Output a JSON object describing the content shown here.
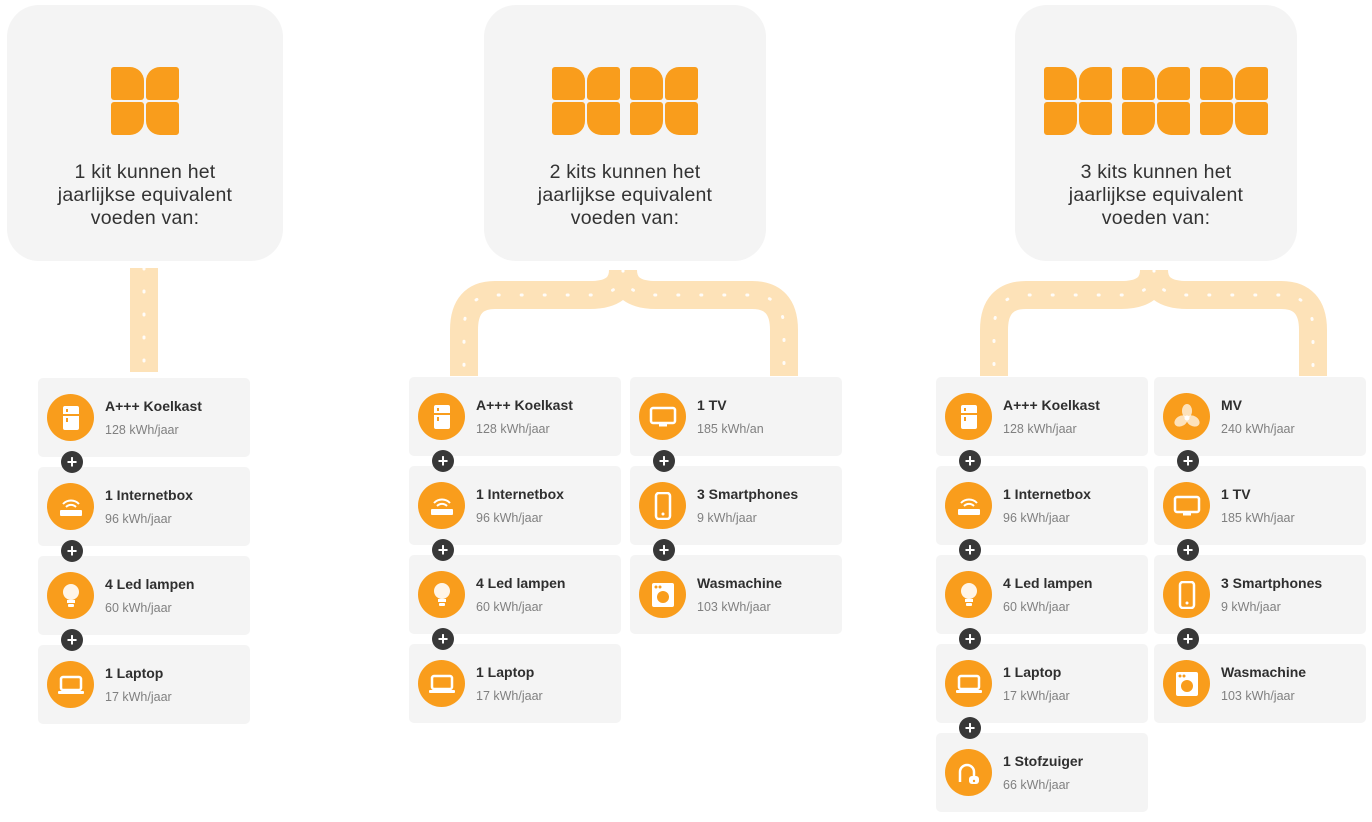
{
  "colors": {
    "accent": "#f99d1c",
    "card_bg": "#f4f4f4",
    "plus_bg": "#383838"
  },
  "groups": [
    {
      "kits": 1,
      "header": [
        "1 kit kunnen het",
        "jaarlijkse equivalent",
        "voeden van:"
      ],
      "columns": [
        [
          {
            "icon": "fridge-icon",
            "name": "A+++ Koelkast",
            "value": "128 kWh/jaar"
          },
          {
            "icon": "internetbox-icon",
            "name": "1 Internetbox",
            "value": "96 kWh/jaar"
          },
          {
            "icon": "led-bulb-icon",
            "name": "4 Led lampen",
            "value": "60 kWh/jaar"
          },
          {
            "icon": "laptop-icon",
            "name": "1 Laptop",
            "value": "17 kWh/jaar"
          }
        ]
      ]
    },
    {
      "kits": 2,
      "header": [
        "2 kits kunnen het",
        "jaarlijkse equivalent",
        "voeden van:"
      ],
      "columns": [
        [
          {
            "icon": "fridge-icon",
            "name": "A+++ Koelkast",
            "value": "128 kWh/jaar"
          },
          {
            "icon": "internetbox-icon",
            "name": "1 Internetbox",
            "value": "96 kWh/jaar"
          },
          {
            "icon": "led-bulb-icon",
            "name": "4 Led lampen",
            "value": "60 kWh/jaar"
          },
          {
            "icon": "laptop-icon",
            "name": "1 Laptop",
            "value": "17 kWh/jaar"
          }
        ],
        [
          {
            "icon": "tv-icon",
            "name": "1 TV",
            "value": "185 kWh/an"
          },
          {
            "icon": "smartphone-icon",
            "name": "3 Smartphones",
            "value": "9 kWh/jaar"
          },
          {
            "icon": "washing-machine-icon",
            "name": "Wasmachine",
            "value": "103 kWh/jaar"
          }
        ]
      ]
    },
    {
      "kits": 3,
      "header": [
        "3 kits kunnen het",
        "jaarlijkse equivalent",
        "voeden van:"
      ],
      "columns": [
        [
          {
            "icon": "fridge-icon",
            "name": "A+++ Koelkast",
            "value": "128 kWh/jaar"
          },
          {
            "icon": "internetbox-icon",
            "name": "1 Internetbox",
            "value": "96 kWh/jaar"
          },
          {
            "icon": "led-bulb-icon",
            "name": "4 Led lampen",
            "value": "60 kWh/jaar"
          },
          {
            "icon": "laptop-icon",
            "name": "1 Laptop",
            "value": "17 kWh/jaar"
          },
          {
            "icon": "vacuum-icon",
            "name": "1 Stofzuiger",
            "value": "66 kWh/jaar"
          }
        ],
        [
          {
            "icon": "ventilation-icon",
            "name": "MV",
            "value": "240 kWh/jaar"
          },
          {
            "icon": "tv-icon",
            "name": "1 TV",
            "value": "185 kWh/jaar"
          },
          {
            "icon": "smartphone-icon",
            "name": "3 Smartphones",
            "value": "9 kWh/jaar"
          },
          {
            "icon": "washing-machine-icon",
            "name": "Wasmachine",
            "value": "103 kWh/jaar"
          }
        ]
      ]
    }
  ]
}
